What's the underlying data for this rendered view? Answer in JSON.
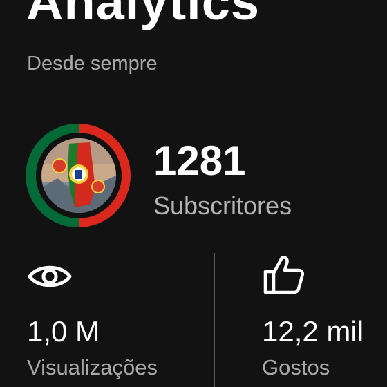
{
  "header": {
    "title": "Analytics",
    "period": "Desde sempre"
  },
  "channel": {
    "avatar_icon": "portugal-flag-avatar-icon",
    "subscribers_count": "1281",
    "subscribers_label": "Subscritores"
  },
  "stats": {
    "views": {
      "icon": "eye-icon",
      "value": "1,0 M",
      "label": "Visualizações"
    },
    "likes": {
      "icon": "thumbs-up-icon",
      "value": "12,2 mil",
      "label": "Gostos"
    }
  },
  "colors": {
    "background": "#121212",
    "text_primary": "#ffffff",
    "text_secondary": "#a8a8a8",
    "flag_green": "#046a38",
    "flag_red": "#da291c"
  }
}
